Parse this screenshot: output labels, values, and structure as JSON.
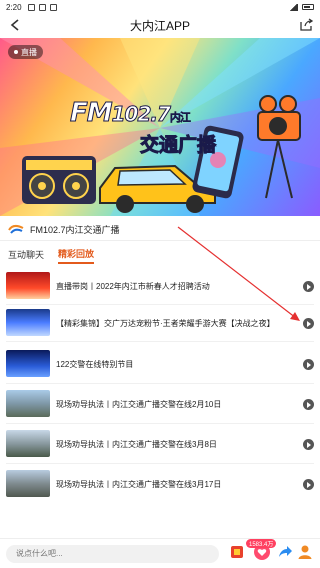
{
  "status_bar": {
    "time": "2:20"
  },
  "header": {
    "title": "大内江APP"
  },
  "banner": {
    "live_label": "直播",
    "fm_text": "FM",
    "frequency": "102.7",
    "city": "内江",
    "brand": "交通广播"
  },
  "station": {
    "name": "FM102.7内江交通广播"
  },
  "tabs": [
    {
      "label": "互动聊天",
      "active": false
    },
    {
      "label": "精彩回放",
      "active": true
    }
  ],
  "playlist": [
    {
      "title": "直播带岗丨2022年内江市新春人才招聘活动",
      "thumb": "recruit"
    },
    {
      "title": "【精彩集锦】交广万达宠粉节·王者荣耀手游大赛【决战之夜】",
      "thumb": "game"
    },
    {
      "title": "122交警在线特别节目",
      "thumb": "police"
    },
    {
      "title": "现场劝导执法丨内江交通广播交警在线2月10日",
      "thumb": "street1"
    },
    {
      "title": "现场劝导执法丨内江交通广播交警在线3月8日",
      "thumb": "street2"
    },
    {
      "title": "现场劝导执法丨内江交通广播交警在线3月17日",
      "thumb": "street3"
    }
  ],
  "bottom": {
    "comment_placeholder": "说点什么吧...",
    "likes_count": "1583.4万"
  },
  "colors": {
    "accent": "#e35a1c",
    "annotation_arrow": "#e53030"
  }
}
